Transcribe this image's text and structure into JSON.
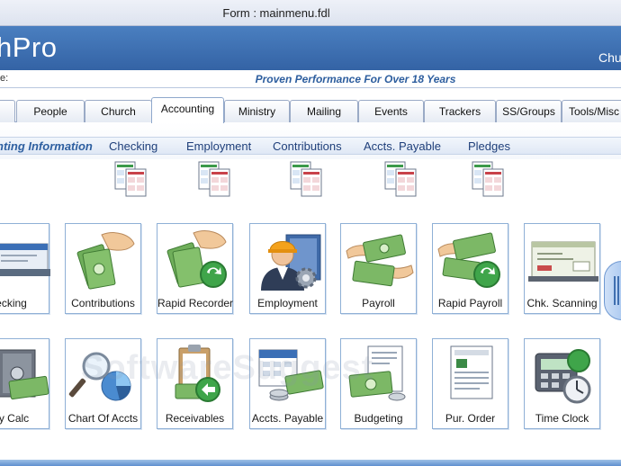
{
  "window": {
    "title": "Form : mainmenu.fdl"
  },
  "banner": {
    "logo_text": "hPro",
    "right_text": "Chu"
  },
  "slogan_bar": {
    "label": "e:",
    "slogan": "Proven Performance For Over 18 Years"
  },
  "tabs": [
    {
      "label": ""
    },
    {
      "label": "People"
    },
    {
      "label": "Church"
    },
    {
      "label": "Accounting"
    },
    {
      "label": "Ministry"
    },
    {
      "label": "Mailing"
    },
    {
      "label": "Events"
    },
    {
      "label": "Trackers"
    },
    {
      "label": "SS/Groups"
    },
    {
      "label": "Tools/Misc"
    }
  ],
  "section": {
    "title": "nting Information",
    "links": [
      {
        "label": "Checking"
      },
      {
        "label": "Employment"
      },
      {
        "label": "Contributions"
      },
      {
        "label": "Accts. Payable"
      },
      {
        "label": "Pledges"
      }
    ]
  },
  "tiles_row1": [
    {
      "label": "ecking",
      "icon": "checkbook-icon"
    },
    {
      "label": "Contributions",
      "icon": "money-hand-icon"
    },
    {
      "label": "Rapid Recorder",
      "icon": "money-hand-refresh-icon"
    },
    {
      "label": "Employment",
      "icon": "worker-gear-icon"
    },
    {
      "label": "Payroll",
      "icon": "money-exchange-icon"
    },
    {
      "label": "Rapid Payroll",
      "icon": "money-exchange-refresh-icon"
    },
    {
      "label": "Chk. Scanning",
      "icon": "check-scanner-icon"
    }
  ],
  "tiles_row2": [
    {
      "label": "sy Calc",
      "icon": "safe-money-icon"
    },
    {
      "label": "Chart Of Accts",
      "icon": "magnifier-pie-icon"
    },
    {
      "label": "Receivables",
      "icon": "clipboard-arrow-icon"
    },
    {
      "label": "Accts. Payable",
      "icon": "calendar-money-icon"
    },
    {
      "label": "Budgeting",
      "icon": "document-money-icon"
    },
    {
      "label": "Pur. Order",
      "icon": "purchase-order-icon"
    },
    {
      "label": "Time Clock",
      "icon": "time-clock-icon"
    }
  ],
  "watermark": {
    "text": "SoftwareSuggest"
  }
}
